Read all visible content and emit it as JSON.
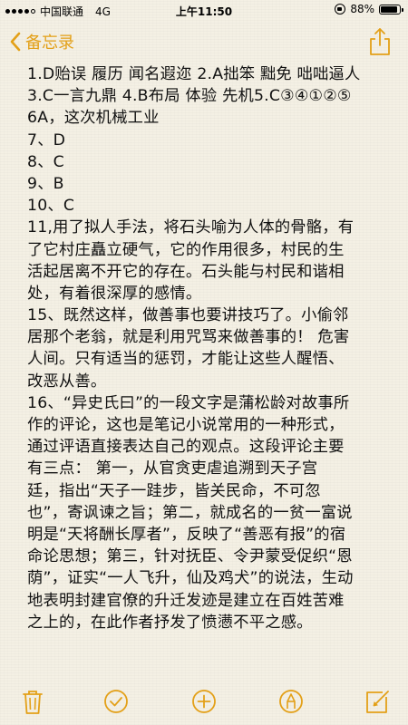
{
  "status_bar": {
    "carrier": "中国联通",
    "network": "4G",
    "time": "上午11:50",
    "battery_text": "88%",
    "battery_level": 0.88
  },
  "nav": {
    "back_label": "备忘录",
    "back_icon": "chevron-left-icon",
    "share_icon": "share-icon",
    "accent_color": "#e3a018"
  },
  "note": {
    "lines": [
      "1.D贻误 履历 闻名遐迩 2.A拙笨 黜免 咄咄逼人",
      "3.C一言九鼎 4.B布局 体验 先机5.C③④①②⑤",
      "6A，这次机械工业",
      "7、D",
      "8、C",
      "9、B",
      "10、C",
      "11,用了拟人手法，将石头喻为人体的骨骼，有",
      "了它村庄矗立硬气，它的作用很多，村民的生",
      "活起居离不开它的存在。石头能与村民和谐相",
      "处，有着很深厚的感情。",
      "15、既然这样，做善事也要讲技巧了。小偷邻",
      "居那个老翁，就是利用咒骂来做善事的！ 危害",
      "人间。只有适当的惩罚，才能让这些人醒悟、",
      "改恶从善。",
      "16、“异史氏曰”的一段文字是蒲松龄对故事所",
      "作的评论，这也是笔记小说常用的一种形式，",
      "通过评语直接表达自己的观点。这段评论主要",
      "有三点：    第一，从官贪吏虐追溯到天子宫",
      "廷，指出“天子一跬步，皆关民命，不可忽",
      "也”，寄讽谏之旨；第二，就成名的一贫一富说",
      "明是“天将酬长厚者”，反映了“善恶有报”的宿",
      "命论思想；第三，针对抚臣、令尹蒙受促织“恩",
      "荫”，证实“一人飞升，仙及鸡犬”的说法，生动",
      "地表明封建官僚的升迁发迹是建立在百姓苦难",
      "之上的，在此作者抒发了愤懑不平之感。"
    ]
  },
  "toolbar": {
    "icons": [
      "trash-icon",
      "checklist-icon",
      "add-icon",
      "markup-pen-icon",
      "compose-icon"
    ]
  }
}
